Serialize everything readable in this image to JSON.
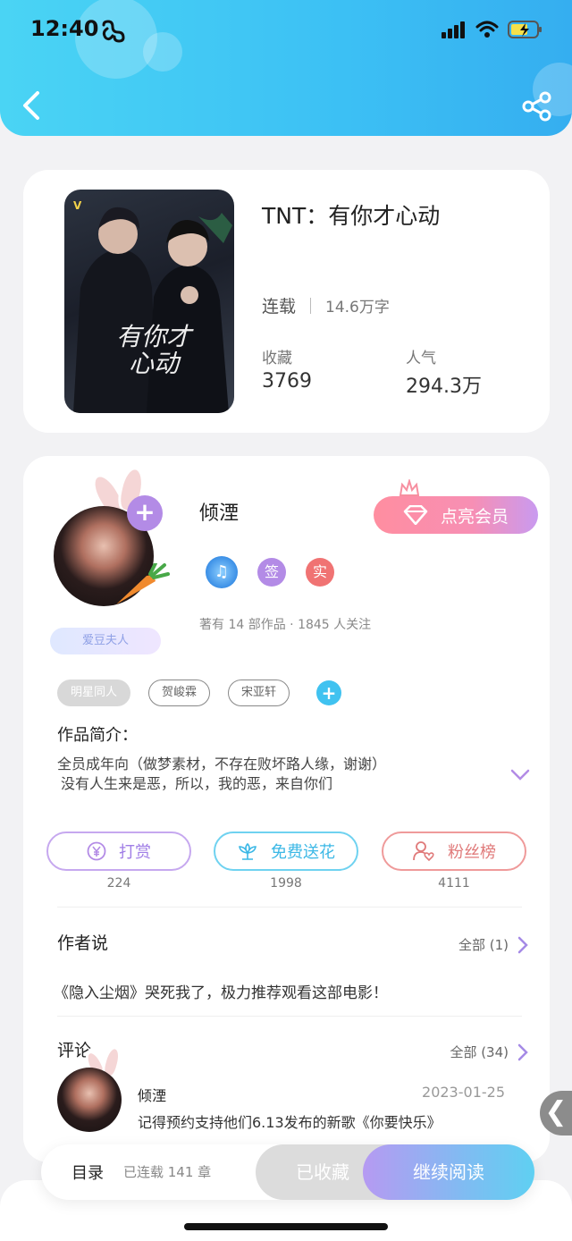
{
  "status_bar": {
    "time": "12:40"
  },
  "book": {
    "title": "TNT：有你才心动",
    "status": "连载",
    "words": "14.6万字",
    "favorites_label": "收藏",
    "favorites_value": "3769",
    "popularity_label": "人气",
    "popularity_value": "294.3万",
    "cover_text": "有你才心动"
  },
  "author": {
    "name": "倾湮",
    "fan_badge": "爱豆夫人",
    "vip_label": "点亮会员",
    "badge_sign": "签",
    "badge_real": "实",
    "stats": "著有 14 部作品 · 1845 人关注",
    "tags": [
      "明星同人",
      "贺峻霖",
      "宋亚轩"
    ],
    "intro_title": "作品简介：",
    "intro_line1": "全员成年向（做梦素材，不存在败坏路人缘，谢谢）",
    "intro_line2": "没有人生来是恶，所以，我的恶，来自你们"
  },
  "actions": {
    "reward_label": "打赏",
    "reward_count": "224",
    "flower_label": "免费送花",
    "flower_count": "1998",
    "fans_label": "粉丝榜",
    "fans_count": "4111"
  },
  "author_say": {
    "title": "作者说",
    "more": "全部 (1)",
    "text": "《隐入尘烟》哭死我了，极力推荐观看这部电影！"
  },
  "comments": {
    "title": "评论",
    "more": "全部 (34)",
    "items": [
      {
        "name": "倾湮",
        "date": "2023-01-25",
        "text": "记得预约支持他们6.13发布的新歌《你要快乐》"
      }
    ]
  },
  "bottom_bar": {
    "toc_label": "目录",
    "toc_count": "已连载 141 章",
    "collected_label": "已收藏",
    "read_label": "继续阅读"
  },
  "colors": {
    "header": "#3cc0f4",
    "purple": "#b38be6",
    "cyan": "#40c2f0",
    "pink": "#f07373"
  }
}
